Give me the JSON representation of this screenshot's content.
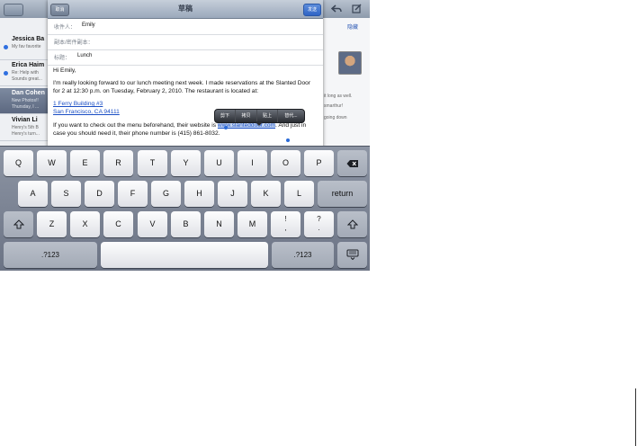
{
  "background_mail": {
    "list_items": [
      {
        "name": "Jessica Ba",
        "line1": "My fav favorite",
        "line2": "",
        "unread": true,
        "selected": false
      },
      {
        "name": "Erica Haim",
        "line1": "Re: Help with",
        "line2": "Sounds great...",
        "unread": true,
        "selected": false
      },
      {
        "name": "Dan Cohen",
        "line1": "New Photos!!",
        "line2": "Thursday, I ...",
        "unread": false,
        "selected": true
      },
      {
        "name": "Vivian Li",
        "line1": "Henry's 5th B",
        "line2": "Henry's turn...",
        "unread": false,
        "selected": false
      }
    ],
    "right_link": "隐藏",
    "right_text": [
      "smarthur!",
      "it long as well.",
      "going down"
    ]
  },
  "compose": {
    "title": "草稿",
    "cancel_label": "取消",
    "send_label": "发送",
    "to_label": "收件人：",
    "to_value": "Emily",
    "cc_label": "副本/密件副本：",
    "subject_label": "标题：",
    "subject_value": "Lunch",
    "greeting": "Hi Emily,",
    "paragraph1": "I'm really looking forward to our lunch meeting next week. I made reservations at the Slanted Door for 2 at 12:30 p.m. on Tuesday, February 2, 2010. The restaurant is located at:",
    "address_line1": "1 Ferry Building #3",
    "address_line2": "San Francisco, CA 94111",
    "paragraph2_before": "If you want to check out the menu beforehand, their website is ",
    "website": "www.slanteddoor.com",
    "paragraph2_after": ". And just in case you should need it, their phone number is (415) 861-8032."
  },
  "edit_menu": [
    "剪下",
    "拷贝",
    "贴上",
    "替代..."
  ],
  "keyboard": {
    "row1": [
      "Q",
      "W",
      "E",
      "R",
      "T",
      "Y",
      "U",
      "I",
      "O",
      "P"
    ],
    "delete_icon": "delete-icon",
    "row2": [
      "A",
      "S",
      "D",
      "F",
      "G",
      "H",
      "J",
      "K",
      "L"
    ],
    "return_label": "return",
    "shift_icon": "shift-icon",
    "row3": [
      "Z",
      "X",
      "C",
      "V",
      "B",
      "N",
      "M"
    ],
    "punct1_top": "!",
    "punct1_bottom": ",",
    "punct2_top": "?",
    "punct2_bottom": ".",
    "numbers_label": ".?123",
    "hide_keyboard_icon": "hide-keyboard-icon"
  },
  "colors": {
    "link": "#1a4ec4",
    "keyboard_bg": "#6b7384"
  }
}
